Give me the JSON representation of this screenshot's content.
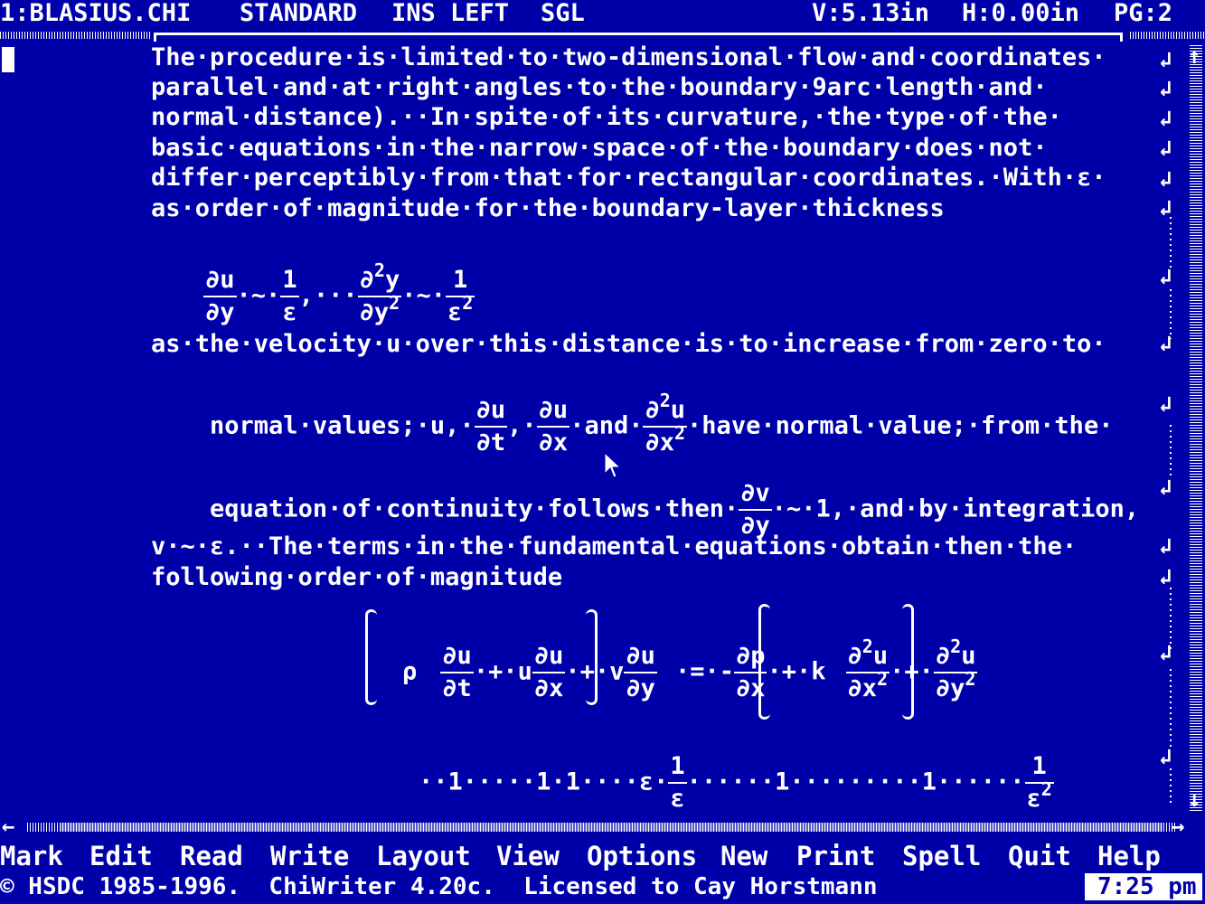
{
  "status": {
    "file": "1:BLASIUS.CHI",
    "mode": "STANDARD",
    "ins": "INS LEFT",
    "spacing": "SGL",
    "v": "V:5.13in",
    "h": "H:0.00in",
    "page": "PG:2"
  },
  "doc": {
    "l1": "The·procedure·is·limited·to·two-dimensional·flow·and·coordinates·",
    "l2": "parallel·and·at·right·angles·to·the·boundary·9arc·length·and·",
    "l3": "normal·distance).··In·spite·of·its·curvature,·the·type·of·the·",
    "l4": "basic·equations·in·the·narrow·space·of·the·boundary·does·not·",
    "l5": "differ·perceptibly·from·that·for·rectangular·coordinates.·With·ε·",
    "l6": "as·order·of·magnitude·for·the·boundary-layer·thickness",
    "l7": "as·the·velocity·u·over·this·distance·is·to·increase·from·zero·to·",
    "l8a": "normal·values;·u,·",
    "l8b": "·and·",
    "l8c": "·have·normal·value;·from·the·",
    "l9a": "equation·of·continuity·follows·then·",
    "l9b": "·~·1,·and·by·integration,",
    "l10": "v·~·ε.··The·terms·in·the·fundamental·equations·obtain·then·the·",
    "l11": "following·order·of·magnitude"
  },
  "math": {
    "du": "∂u",
    "dy": "∂y",
    "one": "1",
    "eps": "ε",
    "sim": "·~·",
    "comma": ",···",
    "d2y": "∂2y",
    "dy2": "∂y2",
    "eps2": "ε2",
    "dt": "∂t",
    "dx": "∂x",
    "d2u": "∂2u",
    "dx2": "∂x2",
    "dv": "∂v",
    "rho": "ρ",
    "plus": "·+·",
    "u": "u",
    "v": "v",
    "eq": "·=·-",
    "dp": "∂p",
    "k": "·+·k",
    "dy2b": "∂y2",
    "order": "··1·····1·1····ε·",
    "order2": "······1·········1······",
    "order_one": "1"
  },
  "menu": [
    "Mark",
    "Edit",
    "Read",
    "Write",
    "Layout",
    "View",
    "Options",
    "New",
    "Print",
    "Spell",
    "Quit",
    "Help"
  ],
  "footer": {
    "copyright": "© HSDC 1985-1996.  ChiWriter 4.20c.  Licensed to Cay Horstmann",
    "clock": "7:25 pm"
  }
}
